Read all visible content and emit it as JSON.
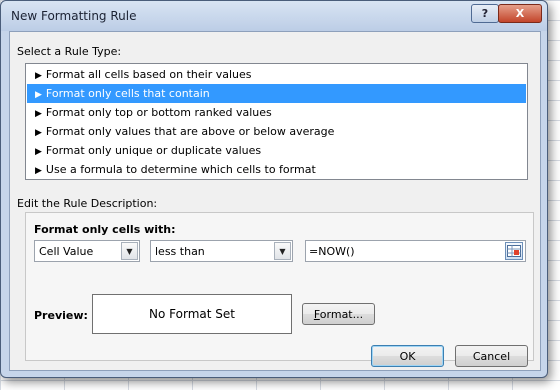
{
  "dialog": {
    "title": "New Formatting Rule",
    "help_label": "?",
    "close_label": "X"
  },
  "select_rule_type": {
    "label": "Select a Rule Type:",
    "items": [
      {
        "label": "Format all cells based on their values",
        "selected": false
      },
      {
        "label": "Format only cells that contain",
        "selected": true
      },
      {
        "label": "Format only top or bottom ranked values",
        "selected": false
      },
      {
        "label": "Format only values that are above or below average",
        "selected": false
      },
      {
        "label": "Format only unique or duplicate values",
        "selected": false
      },
      {
        "label": "Use a formula to determine which cells to format",
        "selected": false
      }
    ]
  },
  "edit_rule": {
    "label": "Edit the Rule Description:",
    "heading": "Format only cells with:",
    "condition_type": "Cell Value",
    "operator": "less than",
    "value": "=NOW()"
  },
  "preview": {
    "label": "Preview:",
    "text": "No Format Set",
    "format_button": "Format..."
  },
  "footer": {
    "ok_label": "OK",
    "cancel_label": "Cancel"
  },
  "colors": {
    "selection": "#3399ff",
    "title_bar": "#c6d5ea",
    "close_button": "#c3452b"
  }
}
